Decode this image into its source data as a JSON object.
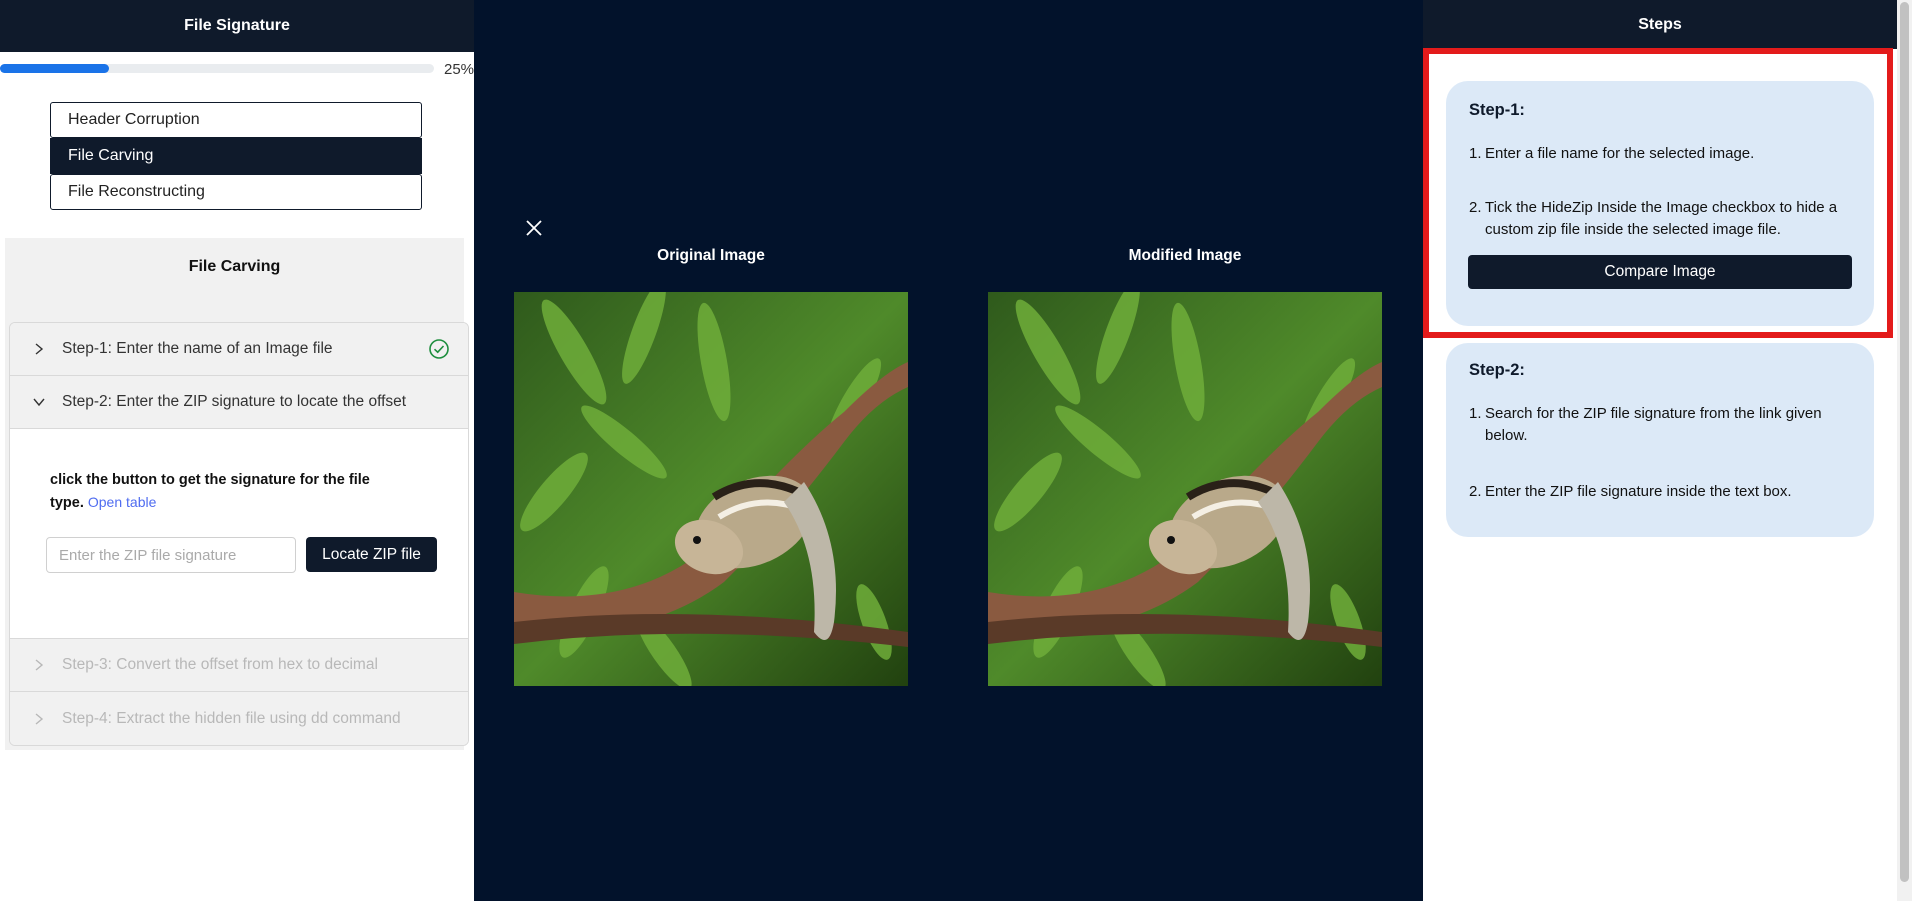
{
  "left": {
    "header": "File Signature",
    "progress": {
      "value": 25,
      "label": "25%"
    },
    "categories": [
      "Header Corruption",
      "File Carving",
      "File Reconstructing"
    ],
    "active_category": "File Carving",
    "section_title": "File Carving",
    "steps": [
      {
        "label": "Step-1: Enter the name of an Image file",
        "state": "completed"
      },
      {
        "label": "Step-2: Enter the ZIP signature to locate the offset",
        "state": "expanded"
      },
      {
        "label": "Step-3: Convert the offset from hex to decimal",
        "state": "disabled"
      },
      {
        "label": "Step-4: Extract the hidden file using dd command",
        "state": "disabled"
      }
    ],
    "step2_body": {
      "instruction": "click the button to get the signature for the file type.",
      "link": "Open table",
      "input_placeholder": "Enter the ZIP file signature",
      "input_value": "",
      "button": "Locate ZIP file"
    }
  },
  "middle": {
    "original_title": "Original Image",
    "modified_title": "Modified Image"
  },
  "right": {
    "header": "Steps",
    "step1": {
      "title": "Step-1:",
      "items": [
        "Enter a file name for the selected image.",
        "Tick the HideZip Inside the Image checkbox to hide a custom zip file inside the selected image file."
      ],
      "button": "Compare Image"
    },
    "step2": {
      "title": "Step-2:",
      "items": [
        "Search for the ZIP file signature from the link given below.",
        "Enter the ZIP file signature inside the text box."
      ]
    }
  },
  "colors": {
    "navy": "#0f1a2b",
    "dark_bg": "#02122b",
    "accent_blue": "#1a73e8",
    "card_bg": "#dce9f7",
    "highlight_red": "#e31b1b",
    "success_green": "#1e8e3e"
  },
  "icons": {
    "close": "close-icon",
    "chevron_right": "chevron-right-icon",
    "chevron_down": "chevron-down-icon",
    "check": "check-circle-icon"
  }
}
